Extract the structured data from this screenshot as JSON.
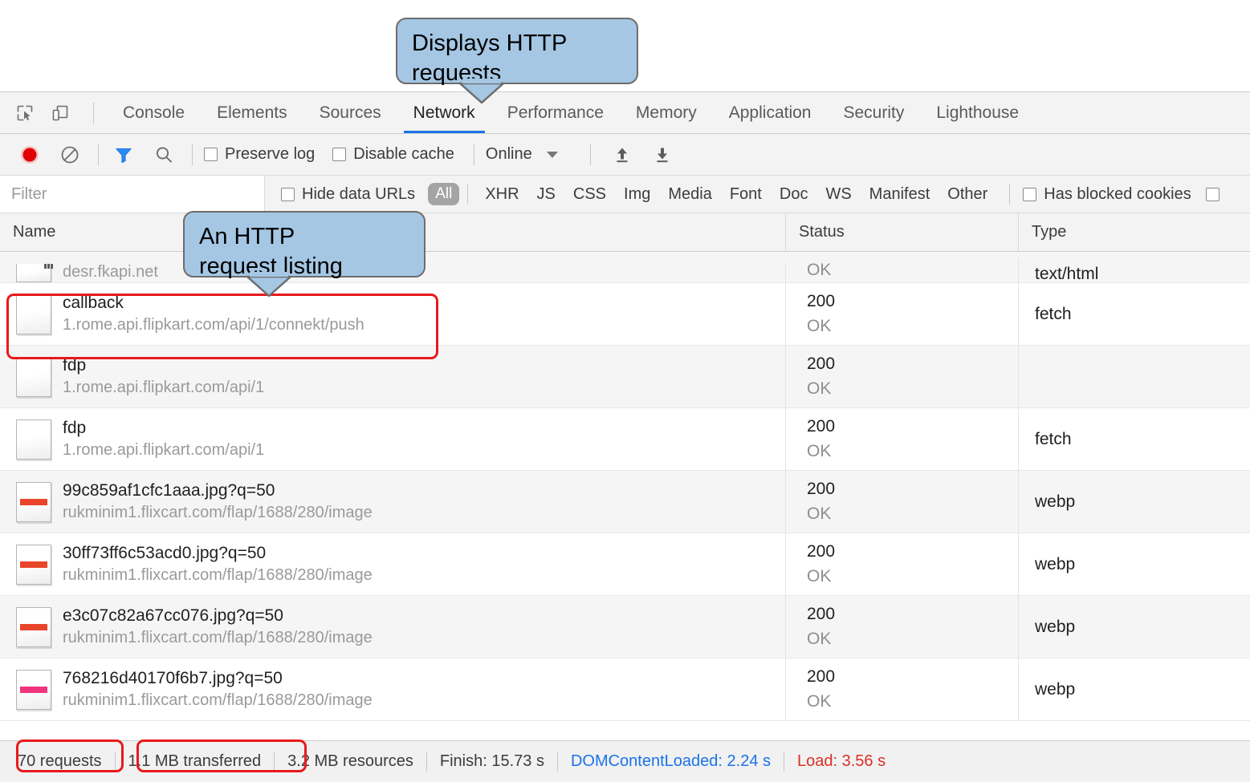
{
  "callouts": [
    {
      "id": "top",
      "text": "Displays HTTP\nrequests"
    },
    {
      "id": "row",
      "text": "An HTTP\nrequest listing"
    }
  ],
  "tabbar": {
    "icons": [
      {
        "name": "inspect-element-icon"
      },
      {
        "name": "device-toolbar-icon"
      }
    ],
    "tabs": [
      {
        "label": "Console",
        "active": false
      },
      {
        "label": "Elements",
        "active": false
      },
      {
        "label": "Sources",
        "active": false
      },
      {
        "label": "Network",
        "active": true
      },
      {
        "label": "Performance",
        "active": false
      },
      {
        "label": "Memory",
        "active": false
      },
      {
        "label": "Application",
        "active": false
      },
      {
        "label": "Security",
        "active": false
      },
      {
        "label": "Lighthouse",
        "active": false
      }
    ]
  },
  "toolbar": {
    "record_icon": "record-icon",
    "clear_icon": "clear-icon",
    "filter_icon": "filter-icon",
    "search_icon": "search-icon",
    "preserve_log_label": "Preserve log",
    "preserve_log_checked": false,
    "disable_cache_label": "Disable cache",
    "disable_cache_checked": false,
    "throttling_value": "Online",
    "import_har_icon": "upload-icon",
    "export_har_icon": "download-icon"
  },
  "filterbar": {
    "filter_placeholder": "Filter",
    "filter_value": "",
    "hide_data_urls_label": "Hide data URLs",
    "hide_data_urls_checked": false,
    "types": [
      "All",
      "XHR",
      "JS",
      "CSS",
      "Img",
      "Media",
      "Font",
      "Doc",
      "WS",
      "Manifest",
      "Other"
    ],
    "selected_type": "All",
    "has_blocked_cookies_label": "Has blocked cookies",
    "has_blocked_cookies_checked": false
  },
  "table": {
    "columns": [
      "Name",
      "Status",
      "Type"
    ],
    "rows": [
      {
        "partial": true,
        "name": "",
        "url": "desr.fkapi.net",
        "status_code": "",
        "status_text": "OK",
        "type": "text/html",
        "thumb": "document",
        "band_color": "",
        "highlighted": false
      },
      {
        "partial": false,
        "name": "callback",
        "url": "1.rome.api.flipkart.com/api/1/connekt/push",
        "status_code": "200",
        "status_text": "OK",
        "type": "fetch",
        "thumb": "blank",
        "band_color": "",
        "highlighted": true
      },
      {
        "partial": false,
        "name": "fdp",
        "url": "1.rome.api.flipkart.com/api/1",
        "status_code": "200",
        "status_text": "OK",
        "type": "",
        "thumb": "blank",
        "band_color": "",
        "highlighted": false
      },
      {
        "partial": false,
        "name": "fdp",
        "url": "1.rome.api.flipkart.com/api/1",
        "status_code": "200",
        "status_text": "OK",
        "type": "fetch",
        "thumb": "blank",
        "band_color": "",
        "highlighted": false
      },
      {
        "partial": false,
        "name": "99c859af1cfc1aaa.jpg?q=50",
        "url": "rukminim1.flixcart.com/flap/1688/280/image",
        "status_code": "200",
        "status_text": "OK",
        "type": "webp",
        "thumb": "image",
        "band_color": "#e8452a",
        "highlighted": false
      },
      {
        "partial": false,
        "name": "30ff73ff6c53acd0.jpg?q=50",
        "url": "rukminim1.flixcart.com/flap/1688/280/image",
        "status_code": "200",
        "status_text": "OK",
        "type": "webp",
        "thumb": "image",
        "band_color": "#e8452a",
        "highlighted": false
      },
      {
        "partial": false,
        "name": "e3c07c82a67cc076.jpg?q=50",
        "url": "rukminim1.flixcart.com/flap/1688/280/image",
        "status_code": "200",
        "status_text": "OK",
        "type": "webp",
        "thumb": "image",
        "band_color": "#e8452a",
        "highlighted": false
      },
      {
        "partial": false,
        "name": "768216d40170f6b7.jpg?q=50",
        "url": "rukminim1.flixcart.com/flap/1688/280/image",
        "status_code": "200",
        "status_text": "OK",
        "type": "webp",
        "thumb": "image",
        "band_color": "#f0347e",
        "highlighted": false
      }
    ]
  },
  "statusbar": {
    "requests": "70 requests",
    "transferred": "1.1 MB transferred",
    "resources": "3.2 MB resources",
    "finish": "Finish: 15.73 s",
    "dom_content_loaded": "DOMContentLoaded: 2.24 s",
    "load": "Load: 3.56 s",
    "dom_content_loaded_color": "#1a73e8",
    "load_color": "#d93025"
  },
  "colors": {
    "accent": "#1a73e8",
    "record_active": "#e00000",
    "filter_active": "#1a73e8",
    "annotation_red": "#e8191b",
    "callout_fill": "#a5c7e4",
    "callout_border": "#6d6d6d"
  }
}
